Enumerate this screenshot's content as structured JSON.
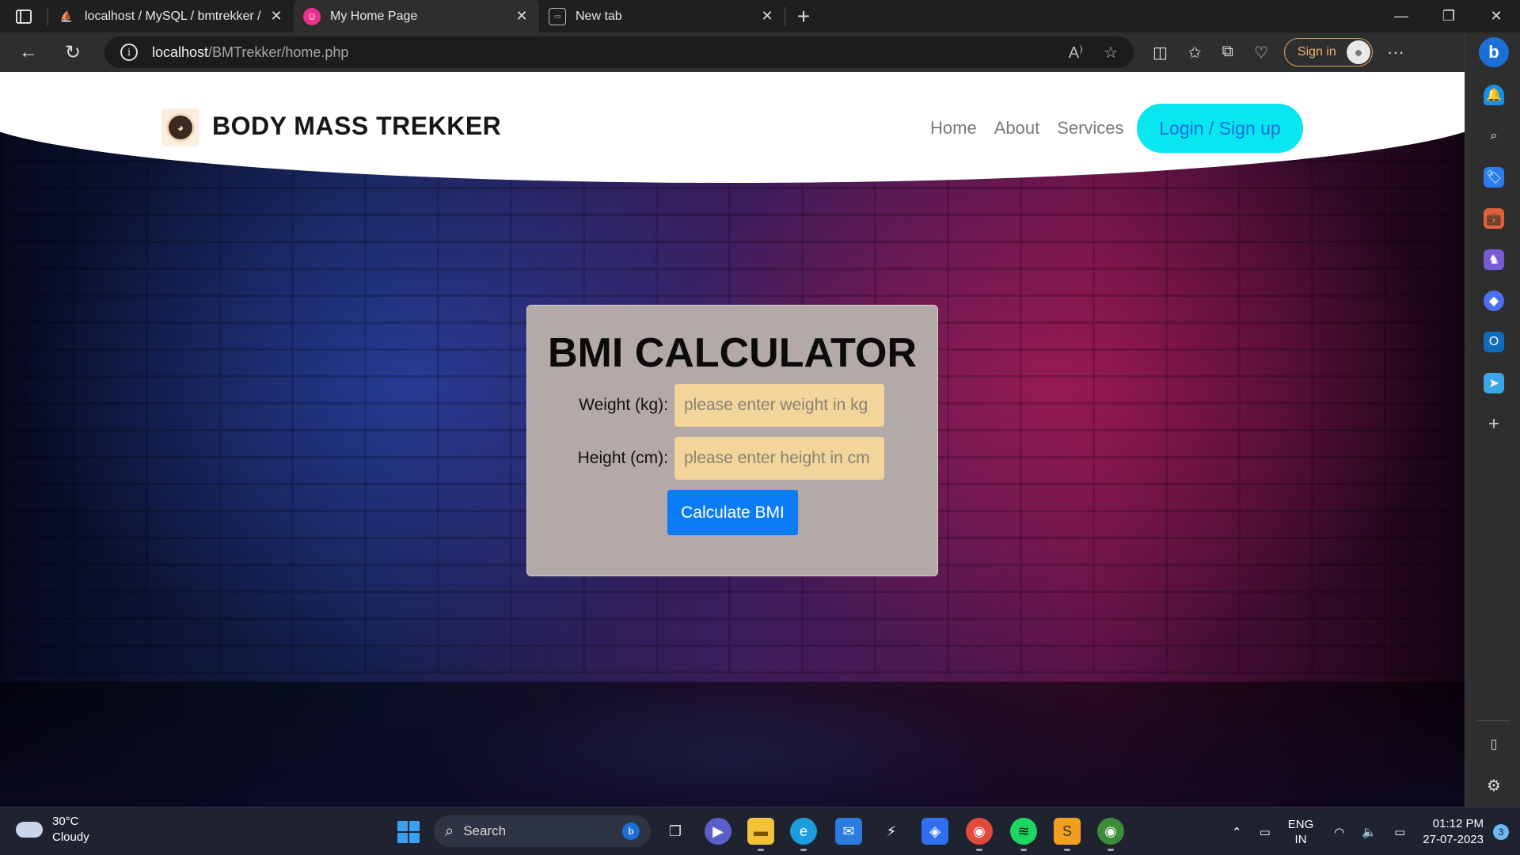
{
  "browser": {
    "tabs": [
      {
        "title": "localhost / MySQL / bmtrekker /",
        "icon": "phpmyadmin-icon",
        "active": false
      },
      {
        "title": "My Home Page",
        "icon": "site-favicon-icon",
        "active": true
      },
      {
        "title": "New tab",
        "icon": "newtab-page-icon",
        "active": false
      }
    ],
    "url_host": "localhost",
    "url_path": "/BMTrekker/home.php",
    "signin_label": "Sign in"
  },
  "site": {
    "brand": "BODY MASS TREKKER",
    "nav": {
      "home": "Home",
      "about": "About",
      "services": "Services",
      "login": "Login / Sign up"
    },
    "colors": {
      "login_bg": "#08e6f0",
      "login_text": "#1a6fd8",
      "card_bg": "#b3a9a7",
      "input_bg": "#f1d59b",
      "button_bg": "#0a7cf7"
    }
  },
  "bmi": {
    "title": "BMI CALCULATOR",
    "weight_label": "Weight (kg):",
    "weight_placeholder": "please enter weight in kg",
    "height_label": "Height (cm):",
    "height_placeholder": "please enter height in cm",
    "button": "Calculate BMI"
  },
  "taskbar": {
    "weather_temp": "30°C",
    "weather_desc": "Cloudy",
    "search_label": "Search",
    "lang_top": "ENG",
    "lang_bottom": "IN",
    "time": "01:12 PM",
    "date": "27-07-2023",
    "notification_count": "3"
  }
}
